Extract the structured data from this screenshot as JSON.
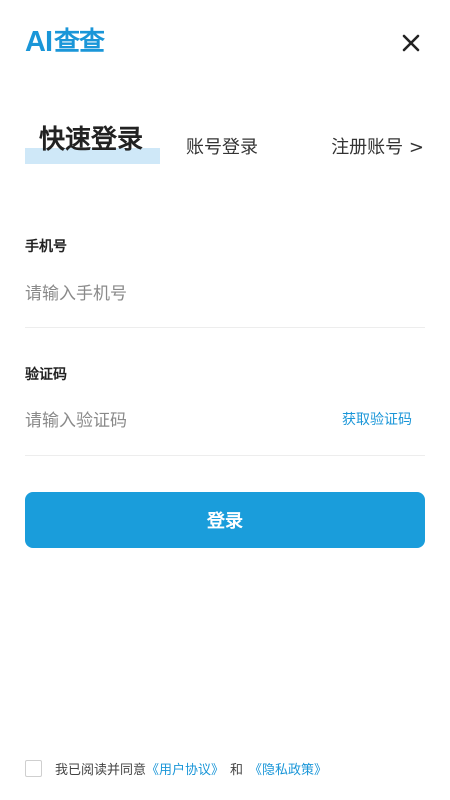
{
  "header": {
    "logo_latin": "AI",
    "logo_cn": "查查",
    "close_icon": "close-icon"
  },
  "tabs": {
    "quick_login": "快速登录",
    "account_login": "账号登录",
    "register": "注册账号 >"
  },
  "form": {
    "phone": {
      "label": "手机号",
      "placeholder": "请输入手机号",
      "value": ""
    },
    "code": {
      "label": "验证码",
      "placeholder": "请输入验证码",
      "value": "",
      "get_code_label": "获取验证码"
    },
    "login_label": "登录"
  },
  "agreement": {
    "prefix": "我已阅读并同意",
    "user_agreement": "《用户协议》",
    "conjunction": "和",
    "privacy_policy": "《隐私政策》",
    "checked": false
  },
  "colors": {
    "accent": "#1a96d8",
    "button": "#1a9ddb",
    "tab_highlight": "#cfe8f8"
  }
}
